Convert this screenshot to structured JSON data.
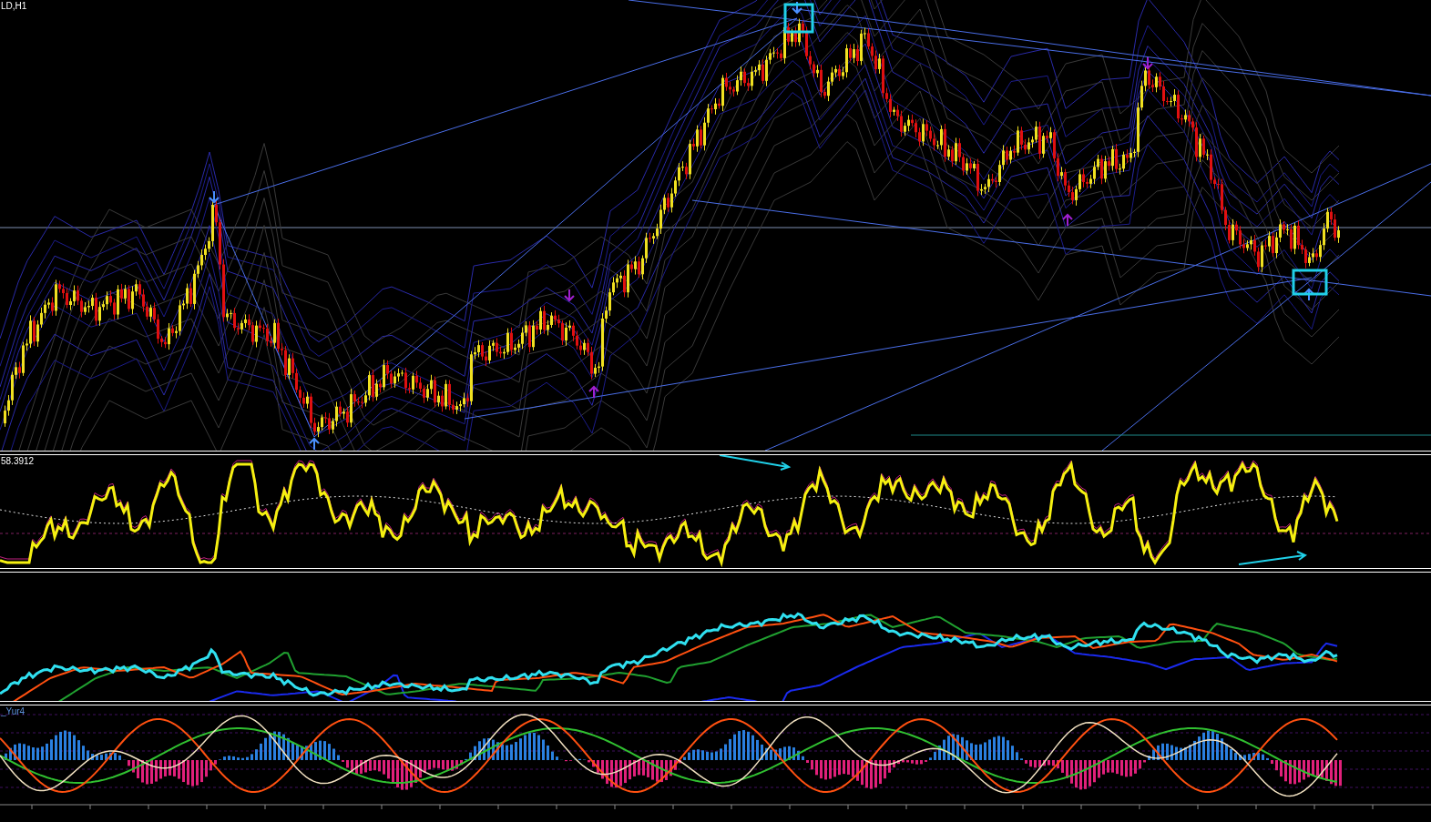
{
  "main_chart": {
    "symbol_label": "LD,H1"
  },
  "oscillator_panel": {
    "value_label": "58.3912"
  },
  "histogram_panel": {
    "indicator_label": "_Yur4"
  }
}
